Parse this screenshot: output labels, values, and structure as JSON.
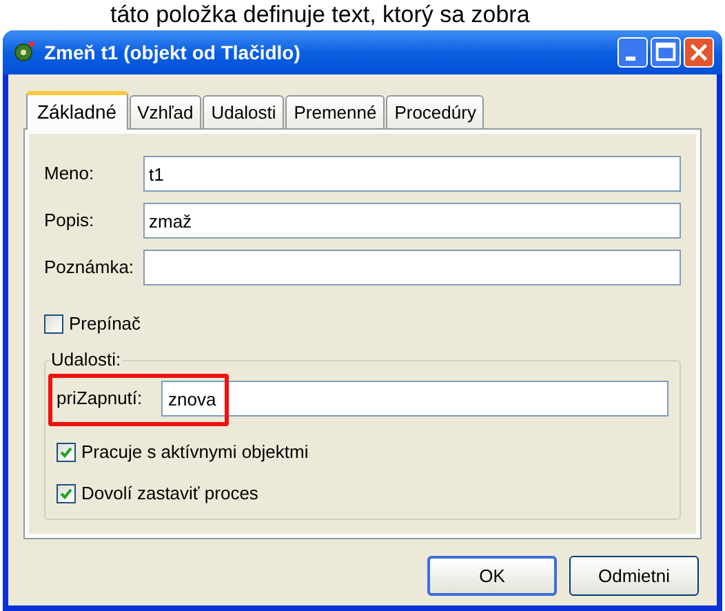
{
  "caption": "táto položka definuje text, ktorý sa zobra",
  "window": {
    "title": "Zmeň t1 (objekt od Tlačidlo)"
  },
  "tabs": [
    {
      "label": "Základné",
      "selected": true
    },
    {
      "label": "Vzhľad",
      "selected": false
    },
    {
      "label": "Udalosti",
      "selected": false
    },
    {
      "label": "Premenné",
      "selected": false
    },
    {
      "label": "Procedúry",
      "selected": false
    }
  ],
  "fields": [
    {
      "label": "Meno:",
      "value": "t1"
    },
    {
      "label": "Popis:",
      "value": "zmaž"
    },
    {
      "label": "Poznámka:"
    }
  ],
  "toggle": {
    "label": "Prepínač",
    "checked": false
  },
  "events_group": {
    "title": "Udalosti:",
    "field": {
      "label": "priZapnutí:",
      "value": "znova",
      "highlighted": true
    },
    "options": [
      {
        "label": "Pracuje s aktívnymi objektmi",
        "checked": true
      },
      {
        "label": "Dovolí zastaviť proces",
        "checked": true
      }
    ]
  },
  "buttons": [
    {
      "label": "OK",
      "default": true
    },
    {
      "label": "Odmietni",
      "default": false
    }
  ]
}
